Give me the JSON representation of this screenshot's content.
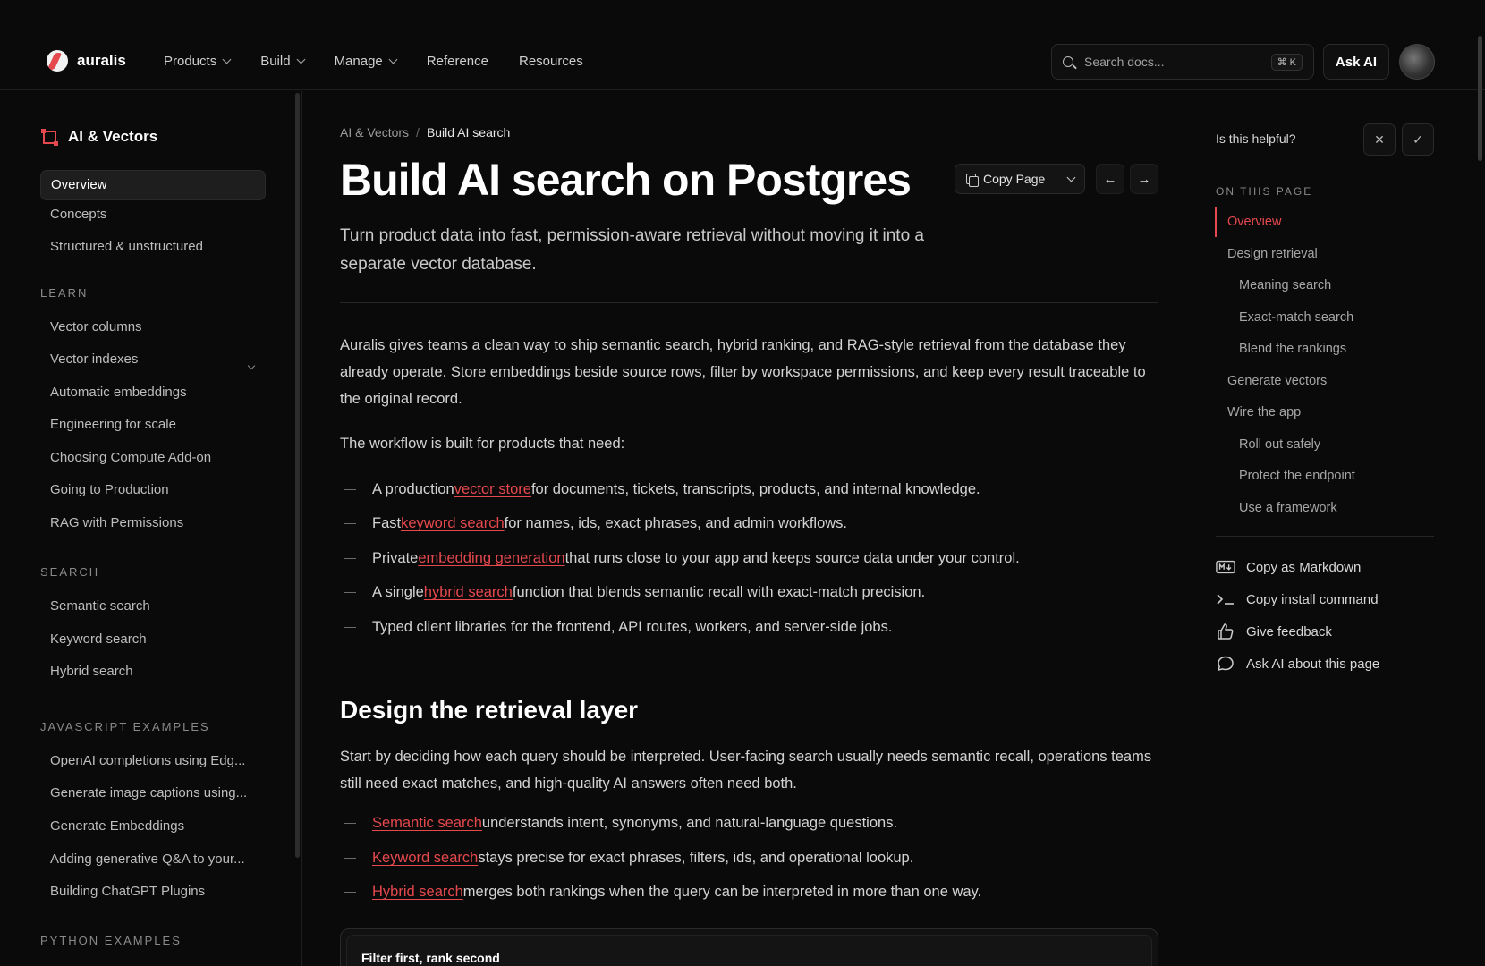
{
  "brand": {
    "name": "auralis"
  },
  "nav": [
    {
      "label": "Products",
      "dropdown": true
    },
    {
      "label": "Build",
      "dropdown": true
    },
    {
      "label": "Manage",
      "dropdown": true
    },
    {
      "label": "Reference",
      "dropdown": false
    },
    {
      "label": "Resources",
      "dropdown": false
    }
  ],
  "search": {
    "placeholder": "Search docs...",
    "shortcut": "⌘ K"
  },
  "ask_ai_label": "Ask AI",
  "sidebar": {
    "heading": "AI & Vectors",
    "top_items": [
      "Overview",
      "Concepts",
      "Structured & unstructured"
    ],
    "sections": [
      {
        "title": "LEARN",
        "items": [
          "Vector columns",
          "Vector indexes",
          "Automatic embeddings",
          "Engineering for scale",
          "Choosing Compute Add-on",
          "Going to Production",
          "RAG with Permissions"
        ]
      },
      {
        "title": "SEARCH",
        "items": [
          "Semantic search",
          "Keyword search",
          "Hybrid search"
        ]
      },
      {
        "title": "JAVASCRIPT EXAMPLES",
        "items": [
          "OpenAI completions using Edg...",
          "Generate image captions using...",
          "Generate Embeddings",
          "Adding generative Q&A to your...",
          "Building ChatGPT Plugins"
        ]
      },
      {
        "title": "PYTHON EXAMPLES",
        "items": []
      }
    ]
  },
  "breadcrumb": {
    "parent": "AI & Vectors",
    "separator": "/",
    "current": "Build AI search"
  },
  "page": {
    "title": "Build AI search on Postgres",
    "copy_label": "Copy Page",
    "subtitle": "Turn product data into fast, permission-aware retrieval without moving it into a separate vector database.",
    "intro": "Auralis gives teams a clean way to ship semantic search, hybrid ranking, and RAG-style retrieval from the database they already operate. Store embeddings beside source rows, filter by workspace permissions, and keep every result traceable to the original record.",
    "workflow_lead": "The workflow is built for products that need:",
    "bullets": [
      {
        "pre": "A production ",
        "link": "vector store",
        "post": " for documents, tickets, transcripts, products, and internal knowledge."
      },
      {
        "pre": "Fast ",
        "link": "keyword search",
        "post": " for names, ids, exact phrases, and admin workflows."
      },
      {
        "pre": "Private ",
        "link": "embedding generation",
        "post": " that runs close to your app and keeps source data under your control."
      },
      {
        "pre": "A single ",
        "link": "hybrid search",
        "post": " function that blends semantic recall with exact-match precision."
      },
      {
        "pre": "Typed client libraries for the frontend, API routes, workers, and server-side jobs.",
        "link": "",
        "post": ""
      }
    ],
    "section2_title": "Design the retrieval layer",
    "section2_para": "Start by deciding how each query should be interpreted. User-facing search usually needs semantic recall, operations teams still need exact matches, and high-quality AI answers often need both.",
    "section2_bullets": [
      {
        "pre": "",
        "link": "Semantic search",
        "post": " understands intent, synonyms, and natural-language questions."
      },
      {
        "pre": "",
        "link": "Keyword search",
        "post": " stays precise for exact phrases, filters, ids, and operational lookup."
      },
      {
        "pre": "",
        "link": "Hybrid search",
        "post": " merges both rankings when the query can be interpreted in more than one way."
      }
    ],
    "callout_title": "Filter first, rank second"
  },
  "right": {
    "helpful": "Is this helpful?",
    "on_this_page": "ON THIS PAGE",
    "toc": [
      {
        "label": "Overview",
        "level": 1,
        "active": true
      },
      {
        "label": "Design retrieval",
        "level": 1,
        "active": false
      },
      {
        "label": "Meaning search",
        "level": 2,
        "active": false
      },
      {
        "label": "Exact-match search",
        "level": 2,
        "active": false
      },
      {
        "label": "Blend the rankings",
        "level": 2,
        "active": false
      },
      {
        "label": "Generate vectors",
        "level": 1,
        "active": false
      },
      {
        "label": "Wire the app",
        "level": 1,
        "active": false
      },
      {
        "label": "Roll out safely",
        "level": 2,
        "active": false
      },
      {
        "label": "Protect the endpoint",
        "level": 2,
        "active": false
      },
      {
        "label": "Use a framework",
        "level": 2,
        "active": false
      }
    ],
    "actions": [
      {
        "label": "Copy as Markdown",
        "icon": "markdown-icon"
      },
      {
        "label": "Copy install command",
        "icon": "terminal-icon"
      },
      {
        "label": "Give feedback",
        "icon": "thumbs-up-icon"
      },
      {
        "label": "Ask AI about this page",
        "icon": "chat-bubble-icon"
      }
    ]
  },
  "colors": {
    "accent": "#e5484d",
    "background": "#0a0a0a"
  }
}
